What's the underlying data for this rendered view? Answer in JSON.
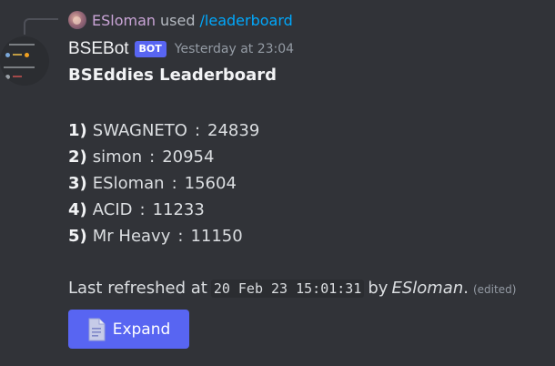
{
  "reply": {
    "user": "ESloman",
    "used": "used",
    "command": "/leaderboard"
  },
  "message": {
    "author": "BSEBot",
    "bot_tag": "BOT",
    "timestamp": "Yesterday at 23:04",
    "title": "BSEddies Leaderboard",
    "entries": [
      {
        "rank": "1)",
        "name": "SWAGNETO",
        "sep": ":",
        "score": "24839"
      },
      {
        "rank": "2)",
        "name": "simon",
        "sep": ":",
        "score": "20954"
      },
      {
        "rank": "3)",
        "name": "ESloman",
        "sep": ":",
        "score": "15604"
      },
      {
        "rank": "4)",
        "name": "ACID",
        "sep": ":",
        "score": "11233"
      },
      {
        "rank": "5)",
        "name": "Mr Heavy",
        "sep": ":",
        "score": "11150"
      }
    ],
    "footer": {
      "prefix": "Last refreshed at",
      "time": "20 Feb 23 15:01:31",
      "by": "by",
      "author": "ESloman",
      "period": ".",
      "edited": "(edited)"
    },
    "expand_button": {
      "label": "Expand",
      "icon": "document-icon"
    }
  },
  "colors": {
    "background": "#313338",
    "accent": "#5865f2",
    "link": "#00a8fc",
    "reply_user": "#c9a4d6"
  }
}
